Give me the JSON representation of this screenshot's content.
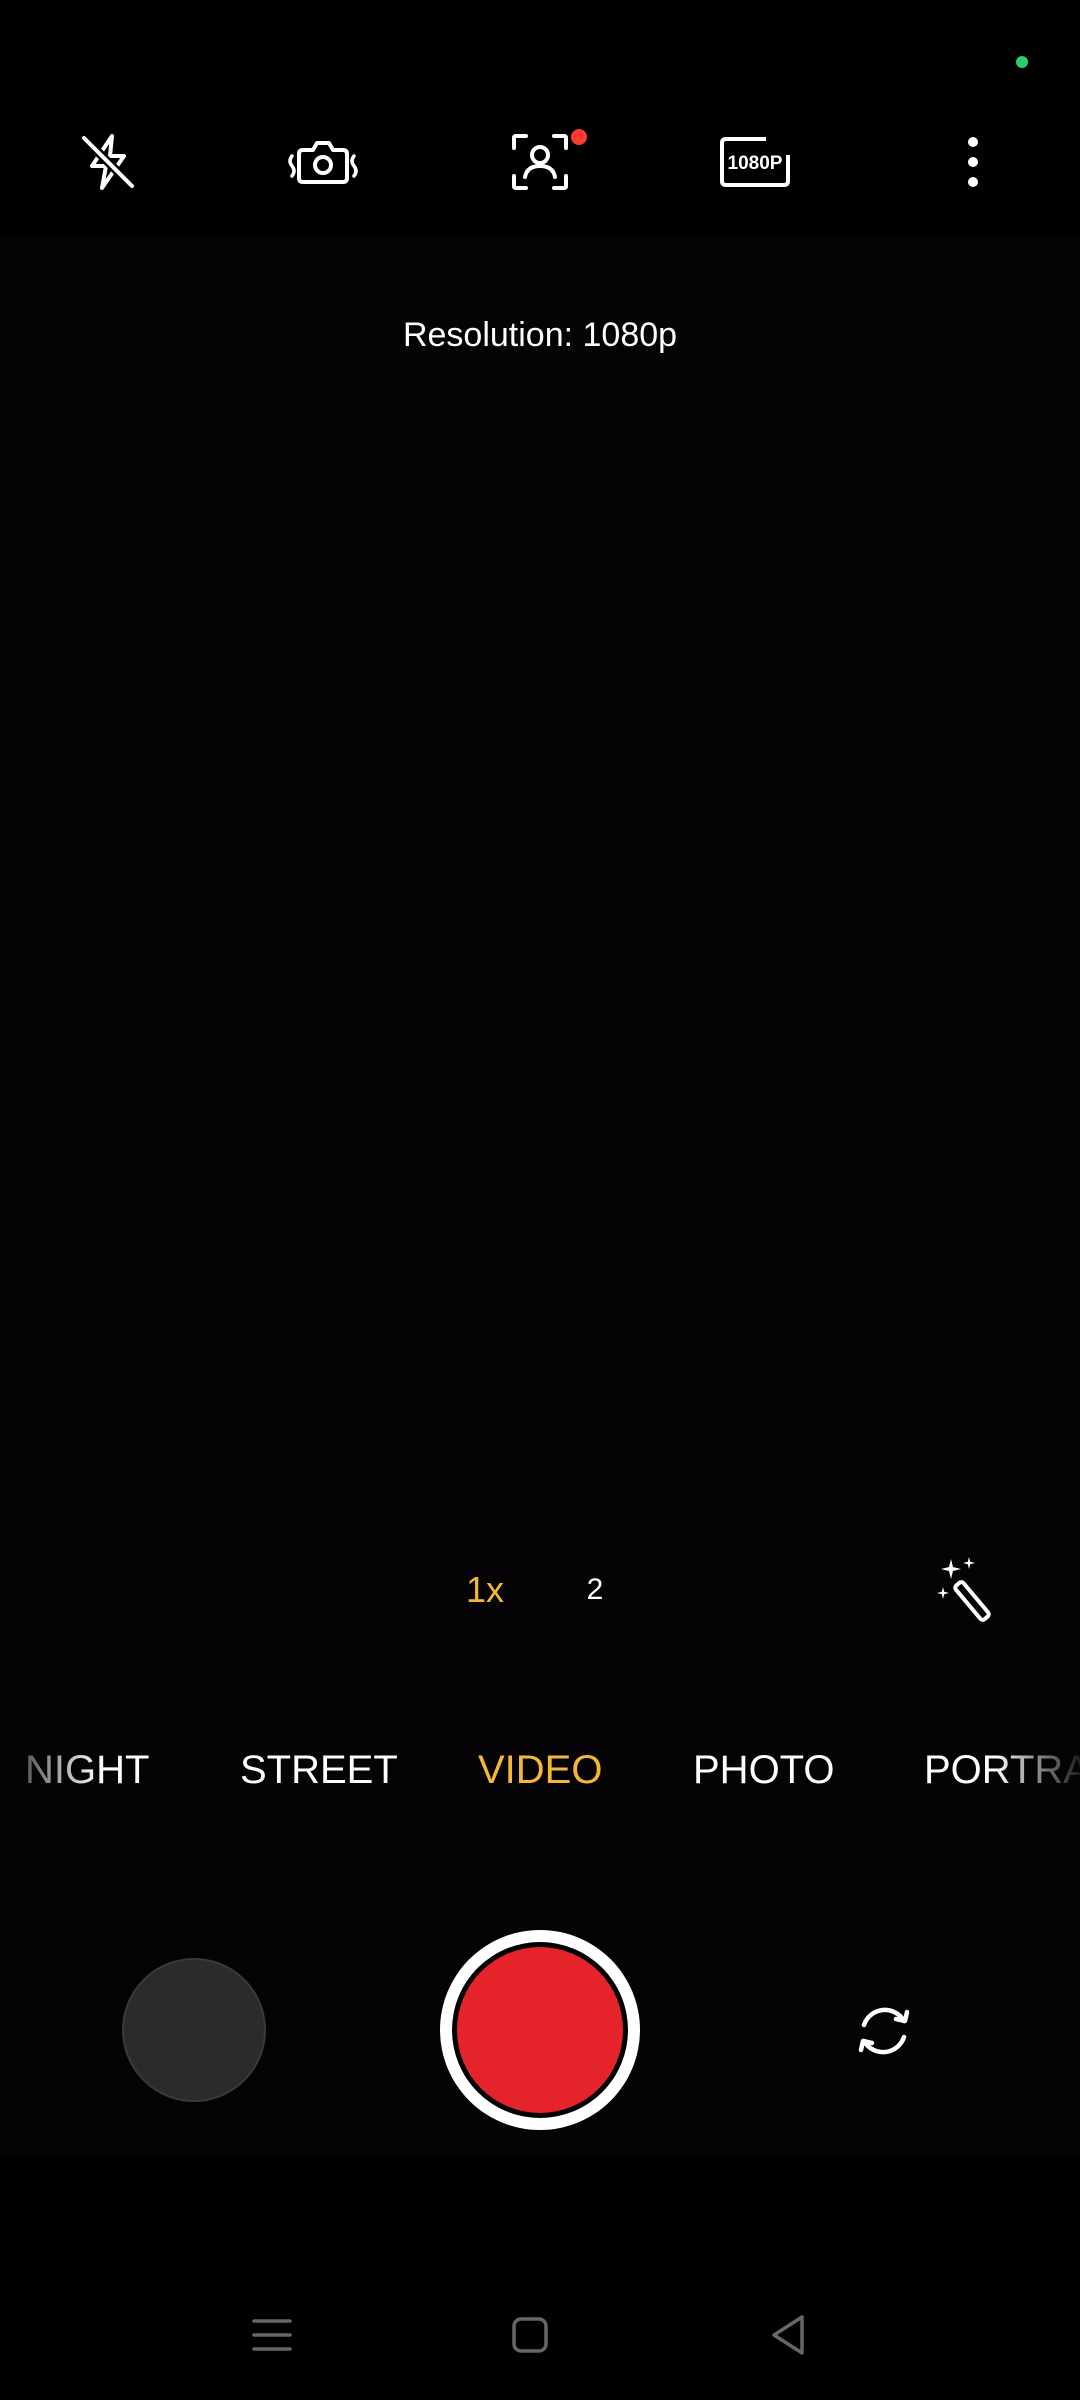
{
  "status_bar": {
    "privacy_indicator_color": "#2ecc71"
  },
  "toolbar": {
    "flash": {
      "icon": "flash-off-icon"
    },
    "stabilization": {
      "icon": "camera-stabilization-icon"
    },
    "face_retouch": {
      "icon": "face-frame-icon",
      "badge_color": "#ff3b30"
    },
    "resolution": {
      "icon": "resolution-1080p-icon",
      "label": "1080P"
    },
    "more": {
      "icon": "more-vertical-icon"
    }
  },
  "viewfinder": {
    "hint": "Resolution: 1080p"
  },
  "zoom": {
    "active": "1x",
    "other": "2"
  },
  "effects": {
    "icon": "magic-wand-icon"
  },
  "modes": {
    "items": [
      "NIGHT",
      "STREET",
      "VIDEO",
      "PHOTO",
      "PORTRAIT"
    ],
    "selected": "VIDEO",
    "accent_color": "#f5b836"
  },
  "controls": {
    "gallery": {
      "icon": "gallery-thumbnail"
    },
    "shutter": {
      "icon": "record-button",
      "color": "#e5232a"
    },
    "switch_camera": {
      "icon": "switch-camera-icon"
    }
  },
  "navigation": {
    "menu": {
      "icon": "menu-icon"
    },
    "home": {
      "icon": "home-icon"
    },
    "back": {
      "icon": "back-icon"
    }
  }
}
